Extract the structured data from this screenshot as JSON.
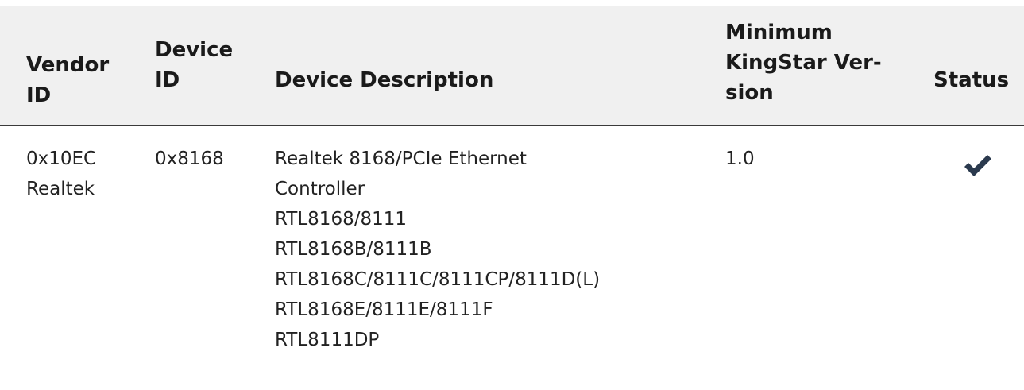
{
  "table": {
    "headers": {
      "vendor_id": [
        "Vendor",
        "ID"
      ],
      "device_id": [
        "Device",
        "ID"
      ],
      "description": "Device Description",
      "min_version": [
        "Minimum",
        "KingStar Ver-",
        "sion"
      ],
      "status": "Status"
    },
    "rows": [
      {
        "vendor_id": [
          "0x10EC",
          "Realtek"
        ],
        "device_id": "0x8168",
        "description": [
          "Realtek 8168/PCIe Ethernet",
          "Controller",
          "RTL8168/8111",
          "RTL8168B/8111B",
          "RTL8168C/8111C/8111CP/8111D(L)",
          "RTL8168E/8111E/8111F",
          "RTL8111DP"
        ],
        "min_version": "1.0",
        "status_icon": "checkmark-icon"
      }
    ]
  },
  "colors": {
    "header_background": "#f0f0f0",
    "header_rule": "#3a3a3a",
    "checkmark": "#2b3a4e"
  }
}
